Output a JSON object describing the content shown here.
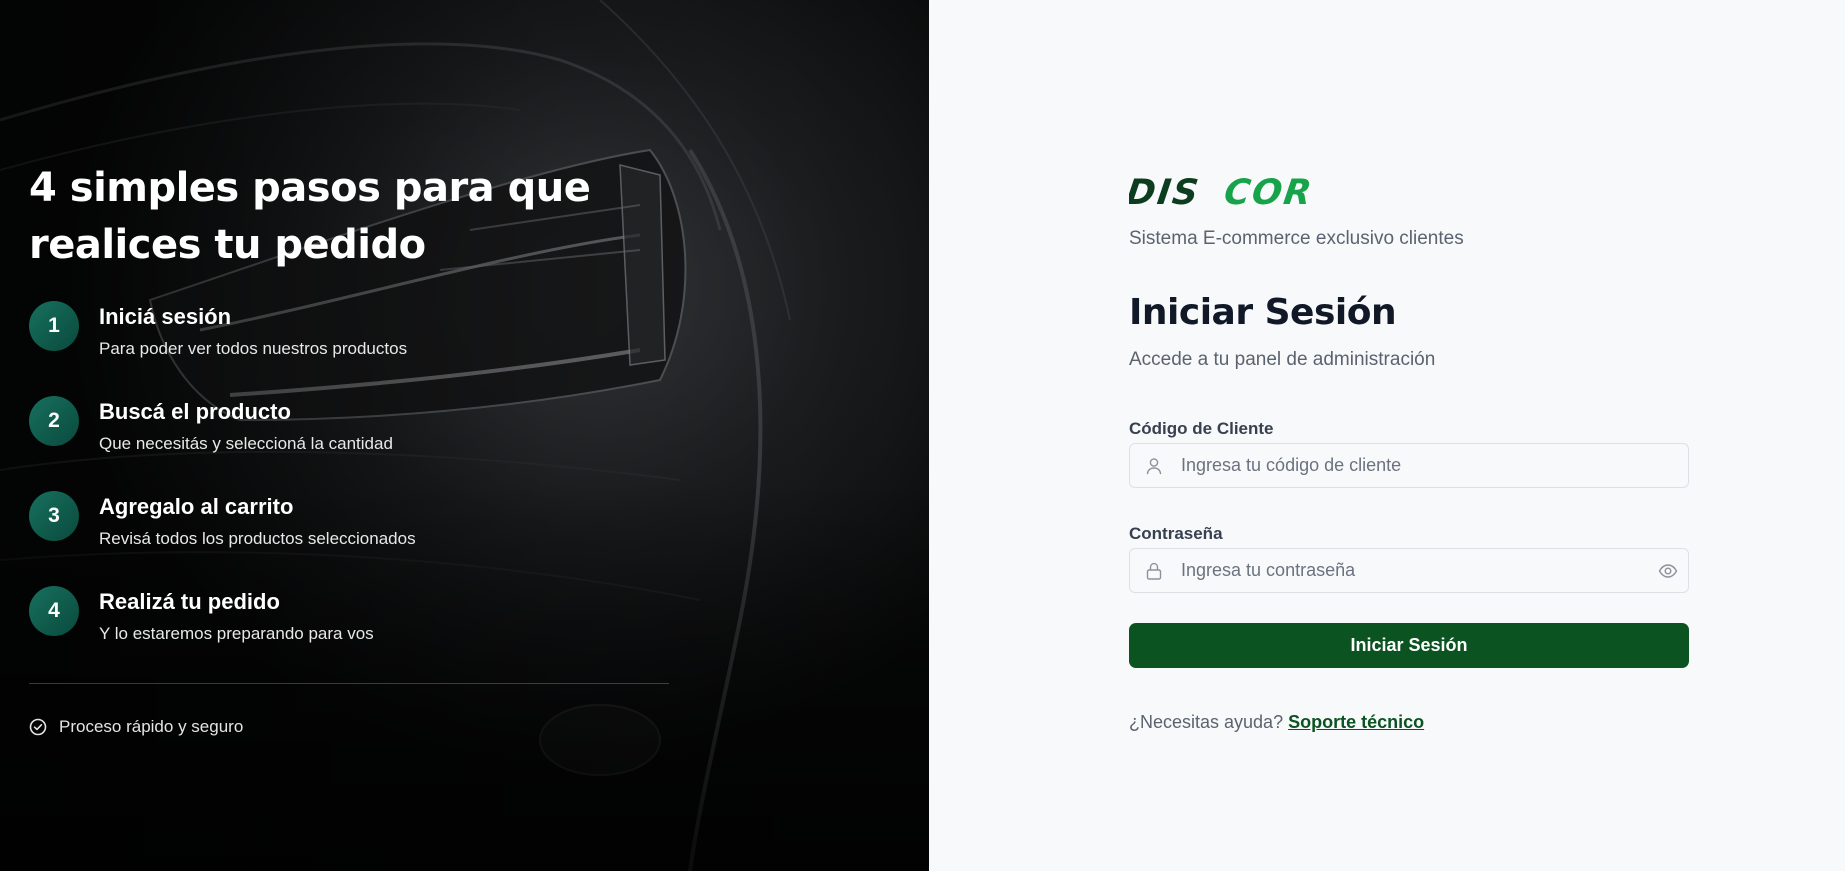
{
  "left_panel": {
    "title": "4 simples pasos para que realices tu pedido",
    "steps": [
      {
        "number": "1",
        "title": "Iniciá sesión",
        "description": "Para poder ver todos nuestros productos"
      },
      {
        "number": "2",
        "title": "Buscá el producto",
        "description": "Que necesitás y seleccioná la cantidad"
      },
      {
        "number": "3",
        "title": "Agregalo al carrito",
        "description": "Revisá todos los productos seleccionados"
      },
      {
        "number": "4",
        "title": "Realizá tu pedido",
        "description": "Y lo estaremos preparando para vos"
      }
    ],
    "footer_text": "Proceso rápido y seguro",
    "footer_icon": "check-circle-icon",
    "background": "car-headlight-photo"
  },
  "login": {
    "logo_text": "DISCOR",
    "system_subtitle": "Sistema E-commerce exclusivo clientes",
    "title": "Iniciar Sesión",
    "subtitle": "Accede a tu panel de administración",
    "client_code": {
      "label": "Código de Cliente",
      "placeholder": "Ingresa tu código de cliente",
      "value": "",
      "icon": "user-icon"
    },
    "password": {
      "label": "Contraseña",
      "placeholder": "Ingresa tu contraseña",
      "value": "",
      "icon": "lock-icon",
      "toggle_icon": "eye-icon"
    },
    "submit_label": "Iniciar Sesión",
    "help_text": "¿Necesitas ayuda?",
    "help_link": "Soporte técnico"
  },
  "colors": {
    "primary_green": "#0b5320",
    "logo_dark_green": "#0c3d1e",
    "logo_bright_green": "#16a34a",
    "step_circle": "#0f5e4e",
    "left_bg": "#0b0c0d",
    "right_bg": "#f8f9fa"
  }
}
